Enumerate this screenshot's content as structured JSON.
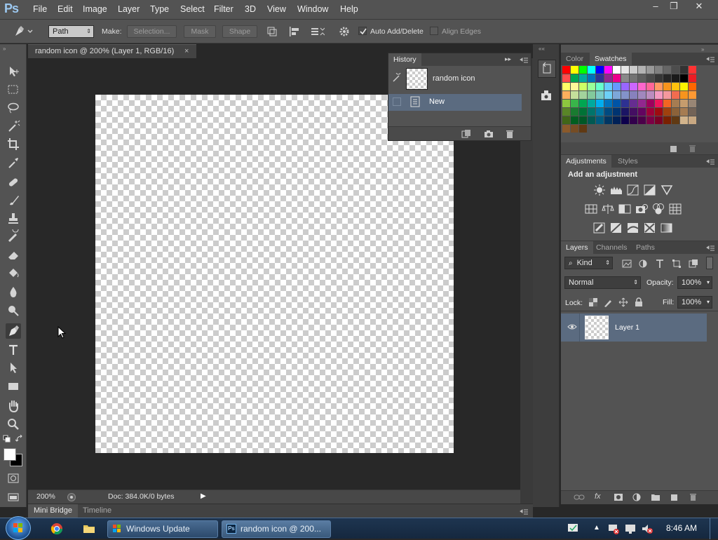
{
  "app": {
    "logo": "Ps"
  },
  "menubar": {
    "items": [
      "File",
      "Edit",
      "Image",
      "Layer",
      "Type",
      "Select",
      "Filter",
      "3D",
      "View",
      "Window",
      "Help"
    ]
  },
  "window_controls": {
    "minimize": "–",
    "restore": "❐",
    "close": "✕"
  },
  "options": {
    "mode": "Path",
    "make_label": "Make:",
    "selection": "Selection...",
    "mask": "Mask",
    "shape": "Shape",
    "auto_add_delete": "Auto Add/Delete",
    "auto_add_delete_checked": true,
    "align_edges": "Align Edges",
    "align_edges_checked": false
  },
  "document": {
    "tab_title": "random icon @ 200% (Layer 1, RGB/16)",
    "zoom": "200%",
    "doc_info": "Doc: 384.0K/0 bytes"
  },
  "bottom_tabs": [
    "Mini Bridge",
    "Timeline"
  ],
  "history": {
    "title": "History",
    "snapshot_name": "random icon",
    "states": [
      "New"
    ]
  },
  "color_panel": {
    "tabs": [
      "Color",
      "Swatches"
    ],
    "selected": "Swatches"
  },
  "swatches": {
    "rows": [
      [
        "#ff0000",
        "#ffff00",
        "#00ff00",
        "#00ffff",
        "#0000ff",
        "#ff00ff",
        "#ffffff",
        "#e6e6e6",
        "#cccccc",
        "#b3b3b3",
        "#999999",
        "#808080",
        "#666666",
        "#4d4d4d",
        "#333333",
        "#ff3333"
      ],
      [
        "#ff4d4d",
        "#00a651",
        "#00a99d",
        "#0072bc",
        "#2e3192",
        "#92278f",
        "#ec008c",
        "#898989",
        "#737373",
        "#5e5e5e",
        "#4a4a4a",
        "#363636",
        "#262626",
        "#1a1a1a",
        "#000000",
        "#ed1c24"
      ],
      [
        "#ffff66",
        "#fff799",
        "#ccff66",
        "#99ff99",
        "#66ffcc",
        "#66ccff",
        "#6699ff",
        "#9966ff",
        "#cc66ff",
        "#ff66cc",
        "#ff6699",
        "#ff9966",
        "#f7941d",
        "#ffc20e",
        "#fff200",
        "#ff6600"
      ],
      [
        "#fbaf5d",
        "#c4df9b",
        "#a3d39c",
        "#82ca9c",
        "#7accc8",
        "#6dcff6",
        "#7da7d9",
        "#8393ca",
        "#8781bd",
        "#a187be",
        "#bc8cbf",
        "#f49ac1",
        "#f5989d",
        "#f26c4f",
        "#f7941d",
        "#ff9933"
      ],
      [
        "#8dc63f",
        "#39b54a",
        "#00a651",
        "#00a99d",
        "#00aeef",
        "#0072bc",
        "#0054a6",
        "#2e3192",
        "#662d91",
        "#92278f",
        "#9e005d",
        "#ed145b",
        "#f26522",
        "#a67c52",
        "#c69c6d",
        "#998675"
      ],
      [
        "#598527",
        "#197b30",
        "#007236",
        "#00746b",
        "#0076a3",
        "#004a80",
        "#003471",
        "#1b1464",
        "#440e62",
        "#630460",
        "#9e0039",
        "#9e0b0f",
        "#a0410d",
        "#8c6239",
        "#a67c52",
        "#736357"
      ],
      [
        "#406618",
        "#005e20",
        "#005826",
        "#005952",
        "#005b7f",
        "#003663",
        "#002157",
        "#0d004c",
        "#32004b",
        "#4b0049",
        "#7b0046",
        "#7a0026",
        "#792000",
        "#603913",
        "#d2b48c",
        "#c8a882"
      ],
      [
        "#8b5a2b",
        "#754c24",
        "#603913"
      ]
    ]
  },
  "adjustments": {
    "tabs": [
      "Adjustments",
      "Styles"
    ],
    "heading": "Add an adjustment"
  },
  "layers": {
    "tabs": [
      "Layers",
      "Channels",
      "Paths"
    ],
    "filter_kind": "Kind",
    "blend_mode": "Normal",
    "opacity_label": "Opacity:",
    "opacity": "100%",
    "lock_label": "Lock:",
    "fill_label": "Fill:",
    "fill": "100%",
    "items": [
      {
        "name": "Layer 1",
        "visible": true
      }
    ]
  },
  "taskbar": {
    "items": [
      "Windows Update",
      "random icon @ 200..."
    ],
    "clock": "8:46 AM"
  },
  "colors": {
    "accent_selected": "#5b6b80",
    "panel_bg": "#535353"
  }
}
